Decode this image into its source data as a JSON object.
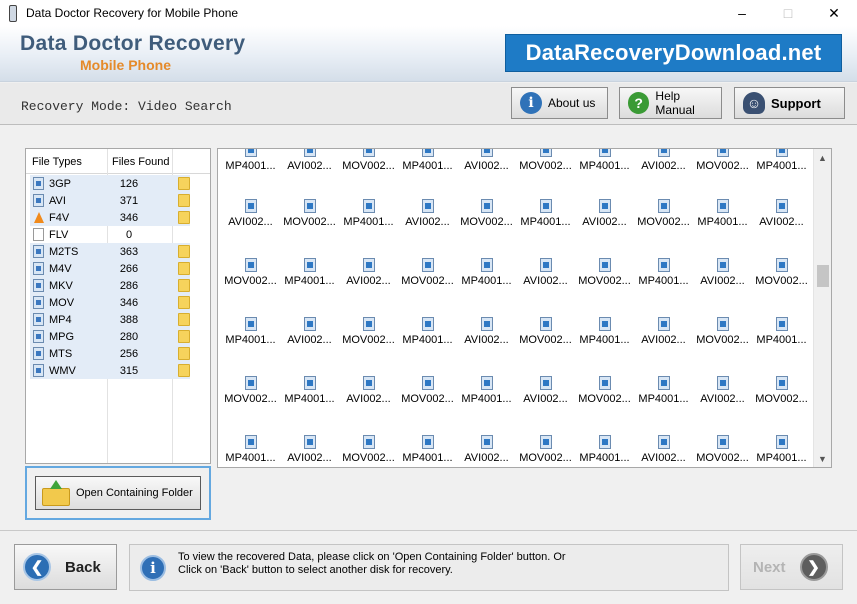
{
  "window": {
    "title": "Data Doctor Recovery for Mobile Phone",
    "minimize": "–",
    "maximize": "□",
    "close": "✕"
  },
  "banner": {
    "title": "Data Doctor Recovery",
    "subtitle": "Mobile Phone",
    "site": "DataRecoveryDownload.net"
  },
  "modebar": {
    "mode_text": "Recovery Mode: Video Search",
    "about_label": "About us",
    "about_icon": "i",
    "help_label": "Help Manual",
    "help_icon": "?",
    "support_label": "Support",
    "support_icon": "☺"
  },
  "file_types": {
    "header_type": "File Types",
    "header_found": "Files Found",
    "rows": [
      {
        "type": "3GP",
        "count": "126",
        "icon": "video-file-icon"
      },
      {
        "type": "AVI",
        "count": "371",
        "icon": "video-file-icon"
      },
      {
        "type": "F4V",
        "count": "346",
        "icon": "vlc-cone-icon"
      },
      {
        "type": "FLV",
        "count": "0",
        "icon": "blank-file-icon"
      },
      {
        "type": "M2TS",
        "count": "363",
        "icon": "video-file-icon"
      },
      {
        "type": "M4V",
        "count": "266",
        "icon": "video-file-icon"
      },
      {
        "type": "MKV",
        "count": "286",
        "icon": "video-file-icon"
      },
      {
        "type": "MOV",
        "count": "346",
        "icon": "video-file-icon"
      },
      {
        "type": "MP4",
        "count": "388",
        "icon": "video-file-icon"
      },
      {
        "type": "MPG",
        "count": "280",
        "icon": "video-file-icon"
      },
      {
        "type": "MTS",
        "count": "256",
        "icon": "video-file-icon"
      },
      {
        "type": "WMV",
        "count": "315",
        "icon": "video-file-icon"
      }
    ]
  },
  "open_folder_label": "Open Containing Folder",
  "files": {
    "rows": [
      [
        "MP4001...",
        "AVI002...",
        "MOV002...",
        "MP4001...",
        "AVI002...",
        "MOV002...",
        "MP4001...",
        "AVI002...",
        "MOV002...",
        "MP4001..."
      ],
      [
        "AVI002...",
        "MOV002...",
        "MP4001...",
        "AVI002...",
        "MOV002...",
        "MP4001...",
        "AVI002...",
        "MOV002...",
        "MP4001...",
        "AVI002..."
      ],
      [
        "MOV002...",
        "MP4001...",
        "AVI002...",
        "MOV002...",
        "MP4001...",
        "AVI002...",
        "MOV002...",
        "MP4001...",
        "AVI002...",
        "MOV002..."
      ],
      [
        "MP4001...",
        "AVI002...",
        "MOV002...",
        "MP4001...",
        "AVI002...",
        "MOV002...",
        "MP4001...",
        "AVI002...",
        "MOV002...",
        "MP4001..."
      ],
      [
        "MOV002...",
        "MP4001...",
        "AVI002...",
        "MOV002...",
        "MP4001...",
        "AVI002...",
        "MOV002...",
        "MP4001...",
        "AVI002...",
        "MOV002..."
      ],
      [
        "MP4001...",
        "AVI002...",
        "MOV002...",
        "MP4001...",
        "AVI002...",
        "MOV002...",
        "MP4001...",
        "AVI002...",
        "MOV002...",
        "MP4001..."
      ]
    ],
    "scroll_up": "▲",
    "scroll_down": "▼"
  },
  "bottom": {
    "back_label": "Back",
    "back_icon": "❮",
    "info_icon": "i",
    "info_line1": "To view the recovered Data, please click on 'Open Containing Folder' button. Or",
    "info_line2": "Click on 'Back' button to select another disk for recovery.",
    "next_label": "Next",
    "next_icon": "❯"
  }
}
